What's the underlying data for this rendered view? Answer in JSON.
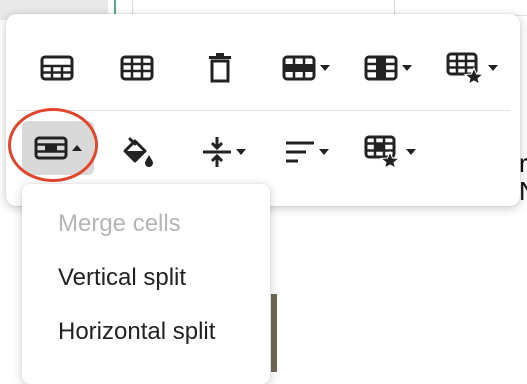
{
  "toolbar": {
    "row1": [
      {
        "icon": "insert-row-above-icon",
        "has_caret": false
      },
      {
        "icon": "insert-row-below-icon",
        "has_caret": false
      },
      {
        "icon": "delete-table-icon",
        "has_caret": false
      },
      {
        "icon": "row-options-icon",
        "has_caret": true
      },
      {
        "icon": "column-options-icon",
        "has_caret": true
      },
      {
        "icon": "table-style-icon",
        "has_caret": true
      }
    ],
    "row2": [
      {
        "icon": "cell-merge-split-icon",
        "has_caret": true,
        "active": true
      },
      {
        "icon": "cell-fill-color-icon",
        "has_caret": false
      },
      {
        "icon": "vertical-align-icon",
        "has_caret": true
      },
      {
        "icon": "horizontal-align-icon",
        "has_caret": true
      },
      {
        "icon": "cell-style-icon",
        "has_caret": true
      }
    ]
  },
  "highlight": {
    "color": "#e2452a"
  },
  "dropdown": {
    "items": [
      {
        "label": "Merge cells",
        "disabled": true
      },
      {
        "label": "Vertical split",
        "disabled": false
      },
      {
        "label": "Horizontal split",
        "disabled": false
      }
    ]
  }
}
